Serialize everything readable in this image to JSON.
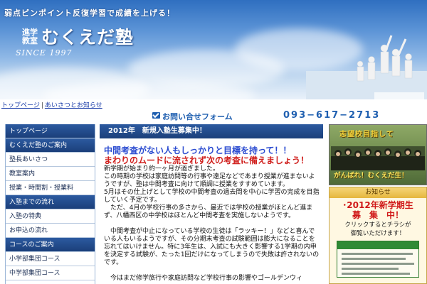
{
  "header": {
    "tagline": "弱点ピンポイント反復学習で成績を上げる！",
    "logo_small": "進学教室",
    "logo_main": "むくえだ塾",
    "since": "SINCE 1997"
  },
  "breadcrumb": {
    "items": [
      "トップページ",
      "あいさつとお知らせ"
    ],
    "separator": "|"
  },
  "contact": {
    "label": "お問い合せフォーム",
    "phone": "093−617−2713"
  },
  "sidebar": {
    "items": [
      {
        "label": "トップページ",
        "type": "head"
      },
      {
        "label": "むくえだ塾のご案内",
        "type": "head"
      },
      {
        "label": "塾長あいさつ",
        "type": "sub"
      },
      {
        "label": "教室案内",
        "type": "sub"
      },
      {
        "label": "授業・時間割・授業料",
        "type": "sub"
      },
      {
        "label": "入塾までの流れ",
        "type": "head"
      },
      {
        "label": "入塾の特典",
        "type": "sub"
      },
      {
        "label": "お申込の流れ",
        "type": "sub"
      },
      {
        "label": "コースのご案内",
        "type": "head"
      },
      {
        "label": "小学部集団コース",
        "type": "sub"
      },
      {
        "label": "中学部集団コース",
        "type": "sub"
      }
    ]
  },
  "main": {
    "heading": "2012年　新規入塾生募集中！",
    "lead1": "中間考査がない人もしっかりと目標を持って！！",
    "lead2": "まわりのムードに流されず次の考査に備えましょう！",
    "paragraphs": [
      "新学期が始まり約一ヶ月が過ぎました。",
      "この時期の学校は家庭訪問等の行事や遠足などであまり授業が進まないようですが、塾は中間考査に向けて順調に授業をすすめています。",
      "5月はその仕上げとして学校の中間考査の過去問を中心に学習の完成を目指していく予定です。",
      "　ただ、4月の学校行事の多さから、最近では学校の授業がほとんど進まず、八幡西区の中学校はほとんど中間考査を実施しないようです。",
      "　中間考査が中止になっている学校の生徒は「ラッキー！」などと喜んでいる人もいるようですが、その分期末考査の試験範囲は膨大になることを忘れてはいけません。特に3年生は、入試にも大きく影響する1学期の内申を決定する試験が、たった1回だけになってしまうので失敗は許されないのです。",
      "　今はまだ修学旅行や家庭訪問など学校行事の影響やゴールデンウィ"
    ]
  },
  "right": {
    "promo_top": "志望校目指して",
    "promo_bottom": "がんばれ！むくえだ生！",
    "news_head": "お知らせ",
    "news_title_1": "･2012年新学期生",
    "news_title_2": "募　集　中！",
    "news_text_1": "クリックするとチラシが",
    "news_text_2": "御覧いただけます！"
  },
  "colors": {
    "nav_blue": "#1b3f7a",
    "lead_blue": "#2a4bd0",
    "lead_red": "#d0201d",
    "phone_blue": "#1f5fb0"
  }
}
